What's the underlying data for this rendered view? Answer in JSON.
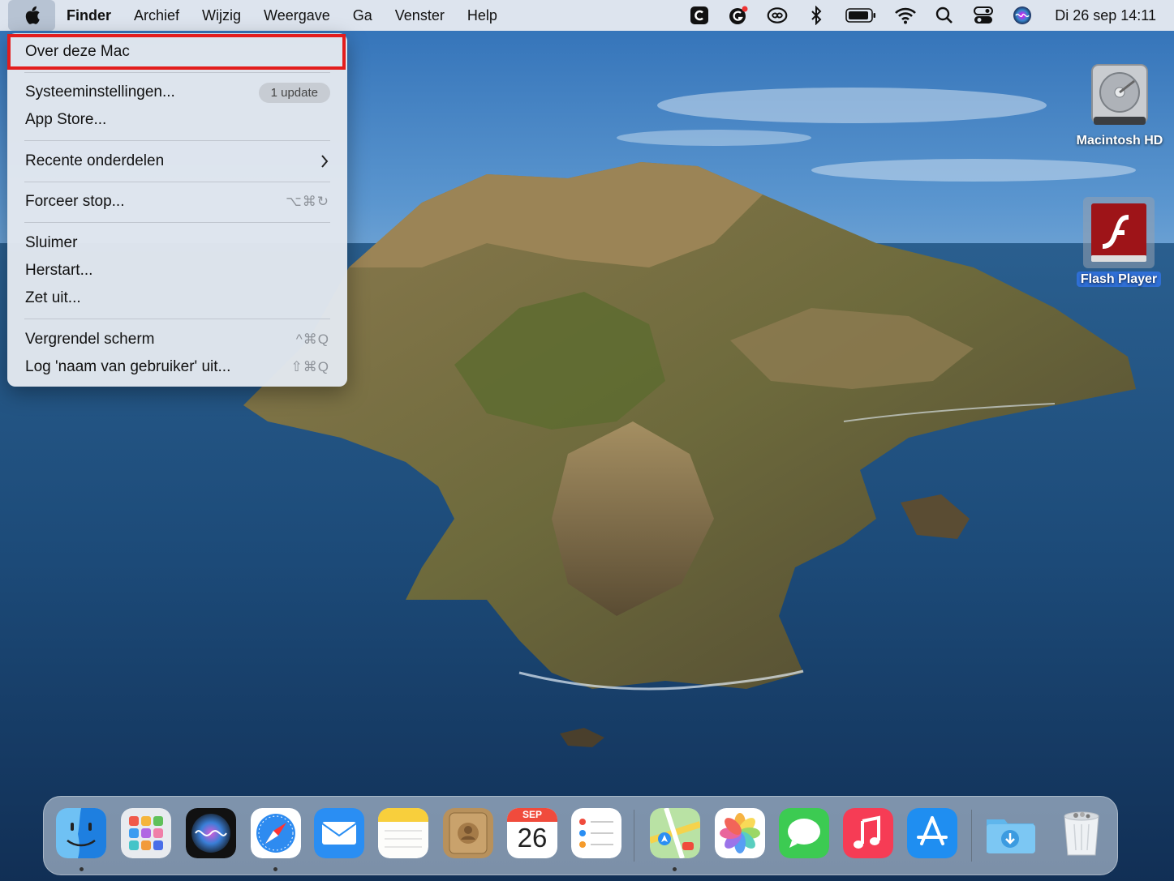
{
  "menubar": {
    "apple_icon": "apple-logo-icon",
    "items": [
      "Finder",
      "Archief",
      "Wijzig",
      "Weergave",
      "Ga",
      "Venster",
      "Help"
    ],
    "status_icons": [
      "c-app-icon",
      "grammarly-icon",
      "creative-cloud-icon",
      "bluetooth-icon",
      "battery-icon",
      "wifi-icon",
      "spotlight-search-icon",
      "control-center-icon",
      "siri-icon"
    ],
    "clock": "Di 26 sep 14:11"
  },
  "apple_menu": {
    "items": [
      {
        "label": "Over deze Mac",
        "highlighted": true
      },
      {
        "label": "Systeeminstellingen...",
        "badge": "1 update"
      },
      {
        "label": "App Store..."
      },
      {
        "label": "Recente onderdelen",
        "submenu_icon": "chevron-right-icon"
      },
      {
        "label": "Forceer stop...",
        "shortcut": "⌥⌘↻"
      },
      {
        "label": "Sluimer"
      },
      {
        "label": "Herstart..."
      },
      {
        "label": "Zet uit..."
      },
      {
        "label": "Vergrendel scherm",
        "shortcut": "^⌘Q"
      },
      {
        "label": "Log 'naam van gebruiker' uit...",
        "shortcut": "⇧⌘Q"
      }
    ]
  },
  "desktop_icons": [
    {
      "label": "Macintosh HD",
      "icon": "hard-drive-icon"
    },
    {
      "label": "Flash Player",
      "icon": "flash-player-icon",
      "selected": true
    }
  ],
  "dock": {
    "apps": [
      {
        "name": "Finder",
        "icon": "finder-icon",
        "running": true
      },
      {
        "name": "Launchpad",
        "icon": "launchpad-icon",
        "running": false
      },
      {
        "name": "Siri",
        "icon": "siri-icon",
        "running": false
      },
      {
        "name": "Safari",
        "icon": "safari-icon",
        "running": true
      },
      {
        "name": "Mail",
        "icon": "mail-icon",
        "running": false
      },
      {
        "name": "Notes",
        "icon": "notes-icon",
        "running": false
      },
      {
        "name": "Contacts",
        "icon": "contacts-icon",
        "running": false
      },
      {
        "name": "Calendar",
        "icon": "calendar-icon",
        "running": false,
        "month": "SEP",
        "day": "26"
      },
      {
        "name": "Reminders",
        "icon": "reminders-icon",
        "running": false
      },
      {
        "name": "Maps",
        "icon": "maps-icon",
        "running": true
      },
      {
        "name": "Photos",
        "icon": "photos-icon",
        "running": false
      },
      {
        "name": "Messages",
        "icon": "messages-icon",
        "running": false
      },
      {
        "name": "Music",
        "icon": "music-icon",
        "running": false
      },
      {
        "name": "App Store",
        "icon": "app-store-icon",
        "running": false
      },
      {
        "name": "Downloads",
        "icon": "downloads-folder-icon",
        "running": false
      },
      {
        "name": "Trash",
        "icon": "trash-icon",
        "running": false
      }
    ]
  },
  "colors": {
    "highlight_border": "#e31d1d",
    "menubar_bg": "#dde4ee",
    "selection_blue": "#2f6fd6"
  }
}
